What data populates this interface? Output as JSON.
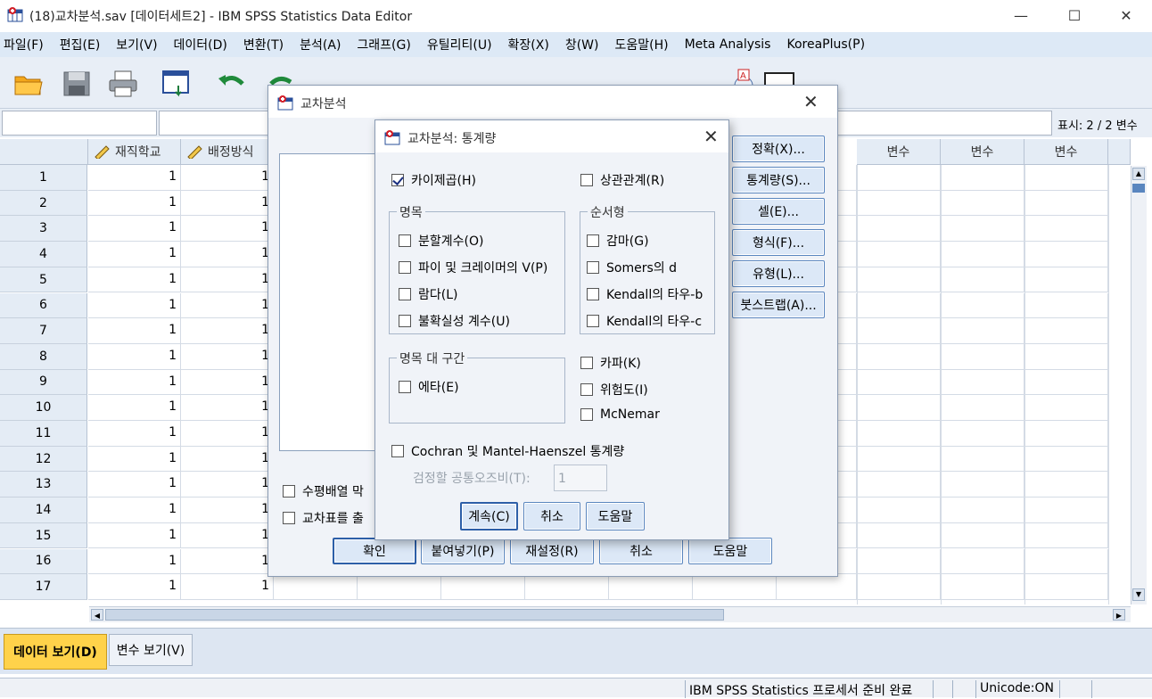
{
  "window": {
    "title": "(18)교차분석.sav [데이터세트2] - IBM SPSS Statistics Data Editor",
    "minimize": "—",
    "maximize": "☐",
    "close": "✕"
  },
  "menu": [
    "파일(F)",
    "편집(E)",
    "보기(V)",
    "데이터(D)",
    "변환(T)",
    "분석(A)",
    "그래프(G)",
    "유틸리티(U)",
    "확장(X)",
    "창(W)",
    "도움말(H)",
    "Meta Analysis",
    "KoreaPlus(P)"
  ],
  "toolbar_icons": [
    "open-folder-icon",
    "save-icon",
    "print-icon",
    "dialog-recall-icon",
    "undo-icon",
    "redo-icon",
    "goto-case-icon",
    "goto-variable-icon",
    "variables-icon",
    "run-descriptives-icon",
    "find-icon",
    "insert-cases-icon",
    "insert-variable-icon",
    "split-file-icon",
    "value-labels-icon",
    "use-sets-icon"
  ],
  "editrow": {
    "display_count": "표시: 2 / 2 변수"
  },
  "grid": {
    "columns": [
      {
        "label": "재직학교",
        "type": "scale"
      },
      {
        "label": "배정방식",
        "type": "scale"
      },
      {
        "label": "변수"
      },
      {
        "label": "변수"
      },
      {
        "label": "변수"
      },
      {
        "label": "변수"
      },
      {
        "label": "변수"
      },
      {
        "label": "변수"
      },
      {
        "label": "변수"
      },
      {
        "label": "변수"
      },
      {
        "label": "변수"
      }
    ],
    "rows": [
      {
        "n": "1",
        "v1": "1",
        "v2": "1"
      },
      {
        "n": "2",
        "v1": "1",
        "v2": "1"
      },
      {
        "n": "3",
        "v1": "1",
        "v2": "1"
      },
      {
        "n": "4",
        "v1": "1",
        "v2": "1"
      },
      {
        "n": "5",
        "v1": "1",
        "v2": "1"
      },
      {
        "n": "6",
        "v1": "1",
        "v2": "1"
      },
      {
        "n": "7",
        "v1": "1",
        "v2": "1"
      },
      {
        "n": "8",
        "v1": "1",
        "v2": "1"
      },
      {
        "n": "9",
        "v1": "1",
        "v2": "1"
      },
      {
        "n": "10",
        "v1": "1",
        "v2": "1"
      },
      {
        "n": "11",
        "v1": "1",
        "v2": "1"
      },
      {
        "n": "12",
        "v1": "1",
        "v2": "1"
      },
      {
        "n": "13",
        "v1": "1",
        "v2": "1"
      },
      {
        "n": "14",
        "v1": "1",
        "v2": "1"
      },
      {
        "n": "15",
        "v1": "1",
        "v2": "1"
      },
      {
        "n": "16",
        "v1": "1",
        "v2": "1"
      },
      {
        "n": "17",
        "v1": "1",
        "v2": "1"
      }
    ]
  },
  "tabs": {
    "data_view": "데이터 보기(D)",
    "variable_view": "변수 보기(V)"
  },
  "status": {
    "processor": "IBM SPSS Statistics 프로세서 준비 완료",
    "unicode": "Unicode:ON"
  },
  "crosstabs_dialog": {
    "title": "교차분석",
    "side_buttons": [
      "정확(X)...",
      "통계량(S)...",
      "셀(E)...",
      "형식(F)...",
      "유형(L)...",
      "붓스트랩(A)..."
    ],
    "options": [
      {
        "label": "수평배열 막",
        "checked": false
      },
      {
        "label": "교차표를 출",
        "checked": false
      }
    ],
    "buttons": {
      "ok": "확인",
      "paste": "붙여넣기(P)",
      "reset": "재설정(R)",
      "cancel": "취소",
      "help": "도움말"
    }
  },
  "statistics_dialog": {
    "title": "교차분석: 통계량",
    "chisquare": {
      "label": "카이제곱(H)",
      "checked": true
    },
    "correlations": {
      "label": "상관관계(R)",
      "checked": false
    },
    "nominal": {
      "title": "명목",
      "items": [
        {
          "label": "분할계수(O)",
          "checked": false
        },
        {
          "label": "파이 및 크레이머의 V(P)",
          "checked": false
        },
        {
          "label": "람다(L)",
          "checked": false
        },
        {
          "label": "불확실성 계수(U)",
          "checked": false
        }
      ]
    },
    "ordinal": {
      "title": "순서형",
      "items": [
        {
          "label": "감마(G)",
          "checked": false
        },
        {
          "label": "Somers의 d",
          "checked": false
        },
        {
          "label": "Kendall의 타우-b",
          "checked": false
        },
        {
          "label": "Kendall의 타우-c",
          "checked": false
        }
      ]
    },
    "nominal_by_interval": {
      "title": "명목 대 구간",
      "items": [
        {
          "label": "에타(E)",
          "checked": false
        }
      ]
    },
    "others": [
      {
        "label": "카파(K)",
        "checked": false
      },
      {
        "label": "위험도(I)",
        "checked": false
      },
      {
        "label": "McNemar",
        "checked": false
      }
    ],
    "cmh": {
      "label": "Cochran 및 Mantel-Haenszel 통계량",
      "checked": false
    },
    "odds_ratio": {
      "label": "검정할 공통오즈비(T):",
      "value": "1"
    },
    "buttons": {
      "continue": "계속(C)",
      "cancel": "취소",
      "help": "도움말"
    }
  }
}
